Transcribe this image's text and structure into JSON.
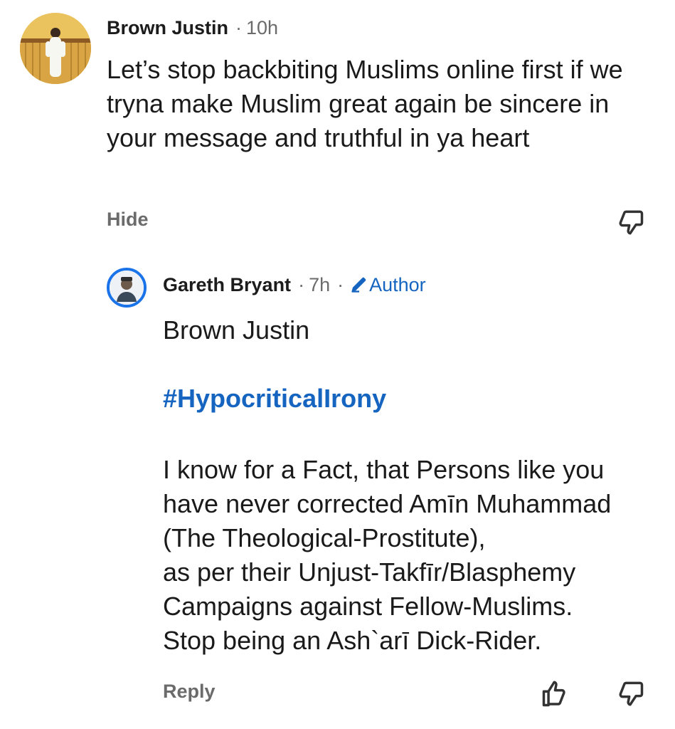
{
  "comment": {
    "author": "Brown Justin",
    "separator": "·",
    "time": "10h",
    "text": "Let’s stop backbiting Muslims online first if we tryna make Muslim great again be sincere in your message and truthful in ya heart",
    "hide_label": "Hide",
    "avatar_icon": "user-photo-avatar",
    "dislike_icon": "thumbs-down-icon"
  },
  "reply": {
    "author": "Gareth Bryant",
    "separator_1": "·",
    "time": "7h",
    "separator_2": "·",
    "badge_icon": "pencil-icon",
    "badge_label": "Author",
    "mention": "Brown Justin",
    "hashtag": "#HypocriticalIrony",
    "body_lines": [
      "I know for a Fact, that Persons like you",
      "have never corrected Amīn Muhammad",
      "(The Theological-Prostitute),",
      "as per their Unjust-Takfīr/Blasphemy",
      "Campaigns against Fellow-Muslims.",
      "Stop being an Ash`arī Dick-Rider."
    ],
    "reply_label": "Reply",
    "like_icon": "thumbs-up-icon",
    "dislike_icon": "thumbs-down-icon"
  },
  "colors": {
    "text": "#1c1c1c",
    "muted": "#6b6b6b",
    "accent": "#1565c0",
    "avatar_ring": "#1a73e8"
  }
}
